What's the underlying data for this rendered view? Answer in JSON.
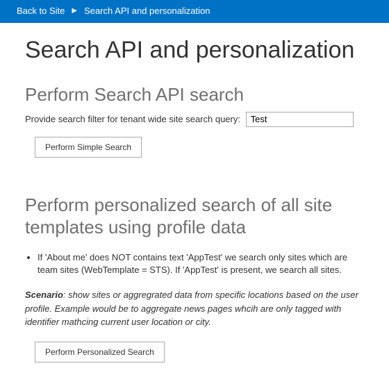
{
  "breadcrumb": {
    "back_label": "Back to Site",
    "current": "Search API and personalization"
  },
  "page": {
    "title": "Search API and personalization"
  },
  "section1": {
    "title": "Perform Search API search",
    "filter_label": "Provide search filter for tenant wide site search query:",
    "filter_value": "Test",
    "button_label": "Perform Simple Search"
  },
  "section2": {
    "title": "Perform personalized search of all site templates using profile data",
    "bullet1": "If 'About me' does NOT contains text 'AppTest' we search only sites which are team sites (WebTemplate = STS). If 'AppTest' is present, we search all sites.",
    "scenario_label": "Scenario",
    "scenario_text": ": show sites or aggregrated data from specific locations based on the user profile. Example would be to aggregate news pages whcih are only tagged with identifier mathcing current user location or city.",
    "button_label": "Perform Personalized Search"
  }
}
